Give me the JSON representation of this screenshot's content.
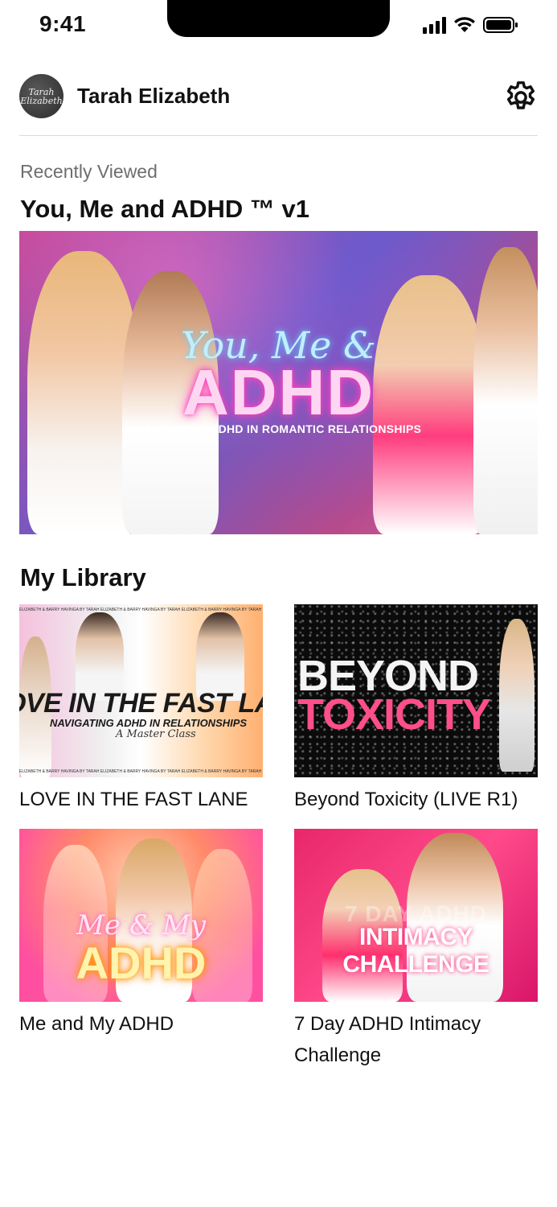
{
  "status_bar": {
    "time": "9:41"
  },
  "header": {
    "avatar_text": "Tarah Elizabeth",
    "user_name": "Tarah Elizabeth",
    "settings_icon": "gear-icon"
  },
  "recently_viewed": {
    "label": "Recently Viewed",
    "title": "You, Me and ADHD ™ v1",
    "thumbnail": {
      "script_text": "You, Me &",
      "main_text": "ADHD",
      "subtitle": "NAVIGATING ADHD IN ROMANTIC RELATIONSHIPS"
    }
  },
  "library": {
    "title": "My Library",
    "items": [
      {
        "title": "LOVE IN THE FAST LANE",
        "thumb_main": "OVE IN THE FAST LAN",
        "thumb_sub": "NAVIGATING ADHD IN RELATIONSHIPS",
        "thumb_script": "A Master Class",
        "thumb_stripe": "ELIZABETH & BARRY HAVINGA BY TARAH ELIZABETH & BARRY HAVINGA BY TARAH ELIZABETH & BARRY HAVINGA BY TARAH ELIZABETH & BARRY HAVINGA BY TA"
      },
      {
        "title": "Beyond Toxicity (LIVE R1)",
        "thumb_line1": "BEYOND",
        "thumb_line2": "TOXICITY"
      },
      {
        "title": "Me and My ADHD",
        "thumb_script": "Me & My",
        "thumb_main": "ADHD"
      },
      {
        "title": "7 Day ADHD Intimacy Challenge",
        "thumb_top": "7 DAY ADHD",
        "thumb_main": "INTIMACY CHALLENGE"
      }
    ]
  },
  "colors": {
    "accent_pink": "#ff4f8a",
    "text_primary": "#111111",
    "text_secondary": "#6e6e6e",
    "divider": "#d9d9d9"
  }
}
